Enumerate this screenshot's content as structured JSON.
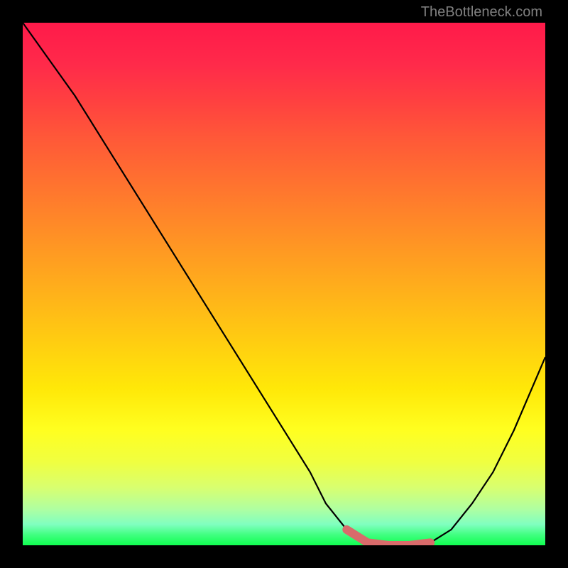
{
  "watermark": "TheBottleneck.com",
  "chart_data": {
    "type": "line",
    "title": "",
    "xlabel": "",
    "ylabel": "",
    "xlim": [
      0,
      100
    ],
    "ylim": [
      0,
      100
    ],
    "series": [
      {
        "name": "bottleneck-curve",
        "x": [
          0,
          5,
          10,
          15,
          20,
          25,
          30,
          35,
          40,
          45,
          50,
          55,
          58,
          62,
          66,
          70,
          74,
          78,
          82,
          86,
          90,
          94,
          100
        ],
        "y": [
          100,
          93,
          86,
          78,
          70,
          62,
          54,
          46,
          38,
          30,
          22,
          14,
          8,
          3,
          0.5,
          0,
          0,
          0.5,
          3,
          8,
          14,
          22,
          36
        ]
      }
    ],
    "highlight": {
      "name": "optimal-range",
      "x_start": 62,
      "x_end": 78,
      "color": "#d96b6b"
    },
    "background_gradient": {
      "top": "#ff1a4a",
      "middle": "#ffe808",
      "bottom": "#10ff50"
    }
  }
}
